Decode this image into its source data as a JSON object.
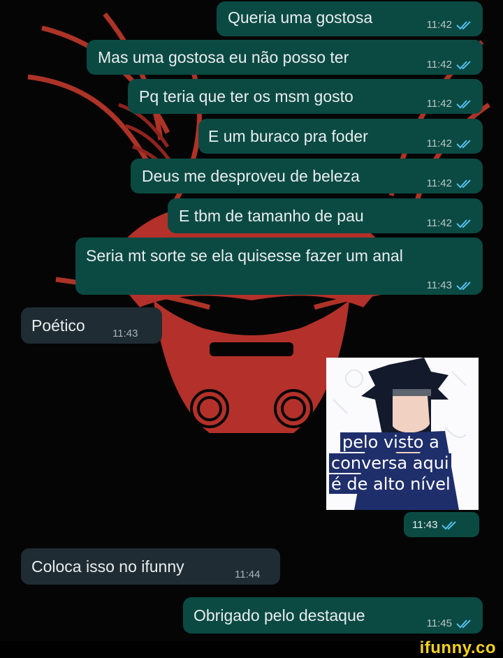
{
  "colors": {
    "outgoing_bubble": "#0b4a43",
    "incoming_bubble": "#202c33",
    "read_ticks": "#53bdeb",
    "wallpaper_art": "#c0392b",
    "ifunny_brand": "#f6d21d"
  },
  "messages": [
    {
      "text": "Queria uma gostosa",
      "time": "11:42",
      "direction": "outgoing",
      "status_icon": "double-check-read-icon"
    },
    {
      "text": "Mas uma gostosa eu não posso ter",
      "time": "11:42",
      "direction": "outgoing",
      "status_icon": "double-check-read-icon"
    },
    {
      "text": "Pq teria que ter os msm gosto",
      "time": "11:42",
      "direction": "outgoing",
      "status_icon": "double-check-read-icon"
    },
    {
      "text": "E um buraco pra foder",
      "time": "11:42",
      "direction": "outgoing",
      "status_icon": "double-check-read-icon"
    },
    {
      "text": "Deus me desproveu de beleza",
      "time": "11:42",
      "direction": "outgoing",
      "status_icon": "double-check-read-icon"
    },
    {
      "text": "E tbm de tamanho de pau",
      "time": "11:42",
      "direction": "outgoing",
      "status_icon": "double-check-read-icon"
    },
    {
      "text": "Seria mt sorte se ela quisesse fazer um anal",
      "time": "11:43",
      "direction": "outgoing",
      "status_icon": "double-check-read-icon"
    },
    {
      "text": "Poético",
      "time": "11:43",
      "direction": "incoming"
    },
    {
      "text": "Coloca isso no ifunny",
      "time": "11:44",
      "direction": "incoming"
    },
    {
      "text": "Obrigado pelo destaque",
      "time": "11:45",
      "direction": "outgoing",
      "status_icon": "double-check-read-icon"
    }
  ],
  "sticker": {
    "lines": [
      "pelo visto a",
      "conversa aqui",
      "é de alto nível"
    ],
    "time": "11:43",
    "status_icon": "double-check-read-icon"
  },
  "watermark": {
    "brand": "ifunny.co"
  }
}
